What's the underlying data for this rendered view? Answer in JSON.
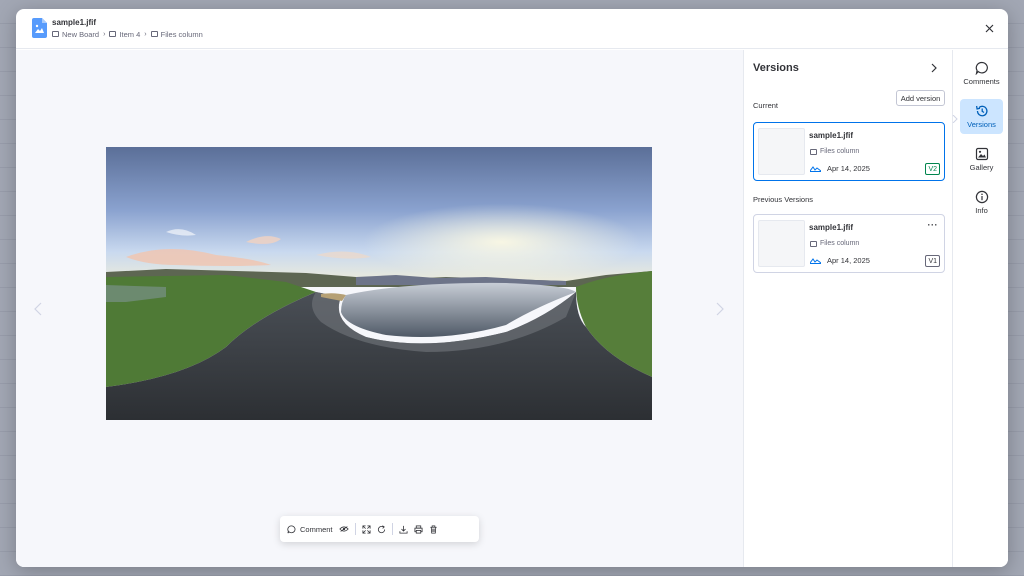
{
  "file": {
    "title": "sample1.jfif",
    "breadcrumb": [
      "New Board",
      "Item 4",
      "Files column"
    ]
  },
  "toolbar": {
    "comment_label": "Comment"
  },
  "versions": {
    "panel_title": "Versions",
    "current_label": "Current",
    "add_version_label": "Add version",
    "previous_label": "Previous Versions",
    "current_version": {
      "name": "sample1.jfif",
      "column": "Files column",
      "date": "Apr 14, 2025",
      "badge": "V2"
    },
    "previous": [
      {
        "name": "sample1.jfif",
        "column": "Files column",
        "date": "Apr 14, 2025",
        "badge": "V1",
        "menu": "···"
      }
    ]
  },
  "rail": {
    "items": [
      {
        "label": "Comments",
        "icon": "comment-icon"
      },
      {
        "label": "Versions",
        "icon": "history-icon",
        "active": true
      },
      {
        "label": "Gallery",
        "icon": "gallery-icon"
      },
      {
        "label": "Info",
        "icon": "info-icon"
      }
    ]
  },
  "colors": {
    "accent": "#0073ea",
    "rail_active_bg": "#cce5ff",
    "badge_current": "#00854d",
    "file_icon": "#579bfc"
  }
}
